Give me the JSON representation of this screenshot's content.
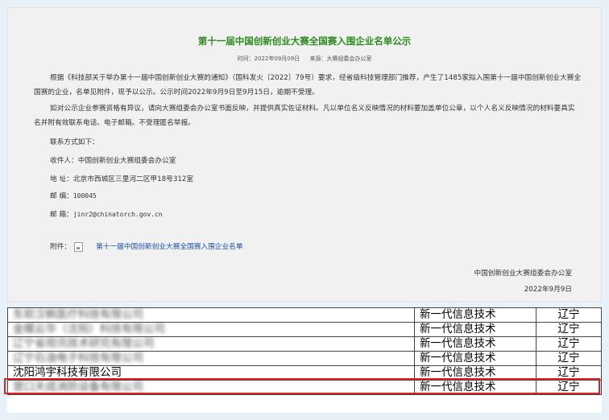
{
  "notice": {
    "title": "第十一届中国创新创业大赛全国赛入围企业名单公示",
    "time": "时间：2022年09月09日",
    "source": "来源：大赛组委会办公室",
    "paragraph1": "根据《科技部关于举办第十一届中国创新创业大赛的通知》（国科发火〔2022〕79号）要求，经省级科技管理部门推荐，产生了1485家拟入围第十一届中国创新创业大赛全国赛的企业，名单见附件，现予以公示。公示时间2022年9月9日至9月15日，逾期不受理。",
    "paragraph2": "如对公示企业参赛资格有异议，请向大赛组委会办公室书面反映，并提供真实佐证材料。凡以单位名义反映情况的材料要加盖单位公章，以个人名义反映情况的材料要具实名并附有效联系电话、电子邮箱。不受理匿名举报。",
    "contact_intro": "联系方式如下：",
    "recipient": "收件人：中国创新创业大赛组委会办公室",
    "address": "地  址：北京市西城区三里河二区甲18号312室",
    "postcode_label": "邮  编：",
    "postcode": "100045",
    "email_label": "邮  箱：",
    "email": "jinr2@chinatorch.gov.cn",
    "attachment_label": "附件：",
    "attachment_link": "第十一届中国创新创业大赛全国赛入围企业名单",
    "signature": "中国创新创业大赛组委会办公室",
    "date": "2022年9月9日"
  },
  "table": {
    "rows": [
      {
        "company": "东软汉枫医疗科技有限公司",
        "field": "新一代信息技术",
        "region": "辽宁",
        "blurred": true
      },
      {
        "company": "金蝶云华（沈阳）科技有限公司",
        "field": "新一代信息技术",
        "region": "辽宁",
        "blurred": true
      },
      {
        "company": "辽宁省视讯技术研究有限公司",
        "field": "新一代信息技术",
        "region": "辽宁",
        "blurred": true
      },
      {
        "company": "辽宁石油电子科技有限公司",
        "field": "新一代信息技术",
        "region": "辽宁",
        "blurred": true
      },
      {
        "company": "沈阳鸿宇科技有限公司",
        "field": "新一代信息技术",
        "region": "辽宁",
        "blurred": false
      },
      {
        "company": "营口天成消防设备有限公司",
        "field": "新一代信息技术",
        "region": "辽宁",
        "blurred": true
      }
    ]
  }
}
